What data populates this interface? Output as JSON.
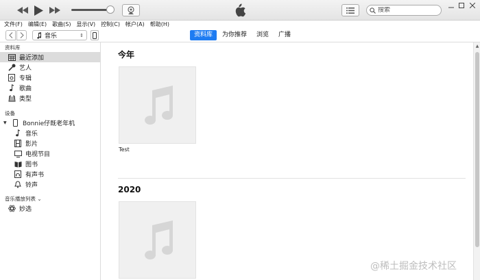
{
  "search": {
    "placeholder": "搜索"
  },
  "menu": [
    "文件(F)",
    "编辑(E)",
    "歌曲(S)",
    "显示(V)",
    "控制(C)",
    "帐户(A)",
    "帮助(H)"
  ],
  "nav": {
    "media_type": "音乐",
    "tabs": [
      "资料库",
      "为你推荐",
      "浏览",
      "广播"
    ],
    "active_tab": "资料库"
  },
  "sidebar": {
    "library_header": "资料库",
    "library_items": [
      "最近添加",
      "艺人",
      "专辑",
      "歌曲",
      "类型"
    ],
    "devices_header": "设备",
    "device_name": "Bonnie仔既老年机",
    "device_items": [
      "音乐",
      "影片",
      "电视节目",
      "图书",
      "有声书",
      "铃声"
    ],
    "playlists_header": "音乐播放列表 ⌄",
    "playlist_items": [
      "妙选"
    ]
  },
  "main": {
    "sections": [
      {
        "title": "今年",
        "albums": [
          {
            "title": "Test"
          }
        ]
      },
      {
        "title": "2020",
        "albums": [
          {
            "title": ""
          }
        ]
      }
    ]
  },
  "watermark": "@稀土掘金技术社区"
}
